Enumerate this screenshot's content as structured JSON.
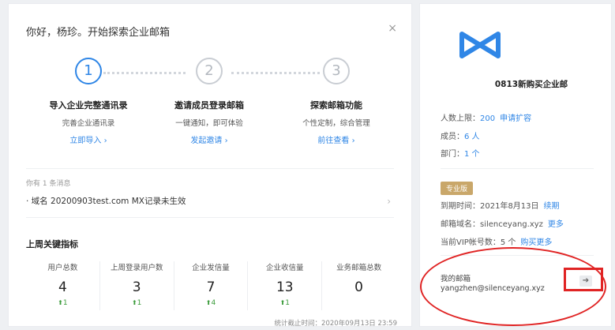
{
  "main": {
    "greeting": "你好，杨珍。开始探索企业邮箱",
    "close_glyph": "×",
    "steps": [
      {
        "num": "1",
        "title": "导入企业完整通讯录",
        "desc": "完善企业通讯录",
        "link": "立即导入 ›"
      },
      {
        "num": "2",
        "title": "邀请成员登录邮箱",
        "desc": "一键通知，即可体验",
        "link": "发起邀请 ›"
      },
      {
        "num": "3",
        "title": "探索邮箱功能",
        "desc": "个性定制，综合管理",
        "link": "前往查看 ›"
      }
    ],
    "messages": {
      "label": "你有 1 条消息",
      "item": "· 域名 20200903test.com MX记录未生效",
      "arrow": "›"
    },
    "kpi": {
      "title": "上周关键指标",
      "items": [
        {
          "label": "用户总数",
          "value": "4",
          "change": "1"
        },
        {
          "label": "上周登录用户数",
          "value": "3",
          "change": "1"
        },
        {
          "label": "企业发信量",
          "value": "7",
          "change": "4"
        },
        {
          "label": "企业收信量",
          "value": "13",
          "change": "1"
        },
        {
          "label": "业务邮箱总数",
          "value": "0",
          "change": ""
        }
      ],
      "up_glyph": "⬆"
    },
    "footnote": "统计截止时间：2020年09月13日 23:59"
  },
  "side": {
    "company": "0813新购买企业邮",
    "quota_label": "人数上限：",
    "quota_value": "200",
    "quota_link": "申请扩容",
    "members_label": "成员：",
    "members_value": "6 人",
    "dept_label": "部门：",
    "dept_value": "1 个",
    "badge": "专业版",
    "expire_label": "到期时间：2021年8月13日",
    "expire_link": "续期",
    "domain_label": "邮箱域名：silenceyang.xyz",
    "domain_link": "更多",
    "vip_label": "当前VIP帐号数：5 个",
    "vip_link": "购买更多",
    "mail_label": "我的邮箱",
    "mail_addr": "yangzhen@silenceyang.xyz",
    "mail_btn": "➔"
  },
  "colors": {
    "accent": "#2f86e6",
    "badge": "#c9a76a",
    "up": "#3a9b3a",
    "annotation": "#e02424"
  }
}
